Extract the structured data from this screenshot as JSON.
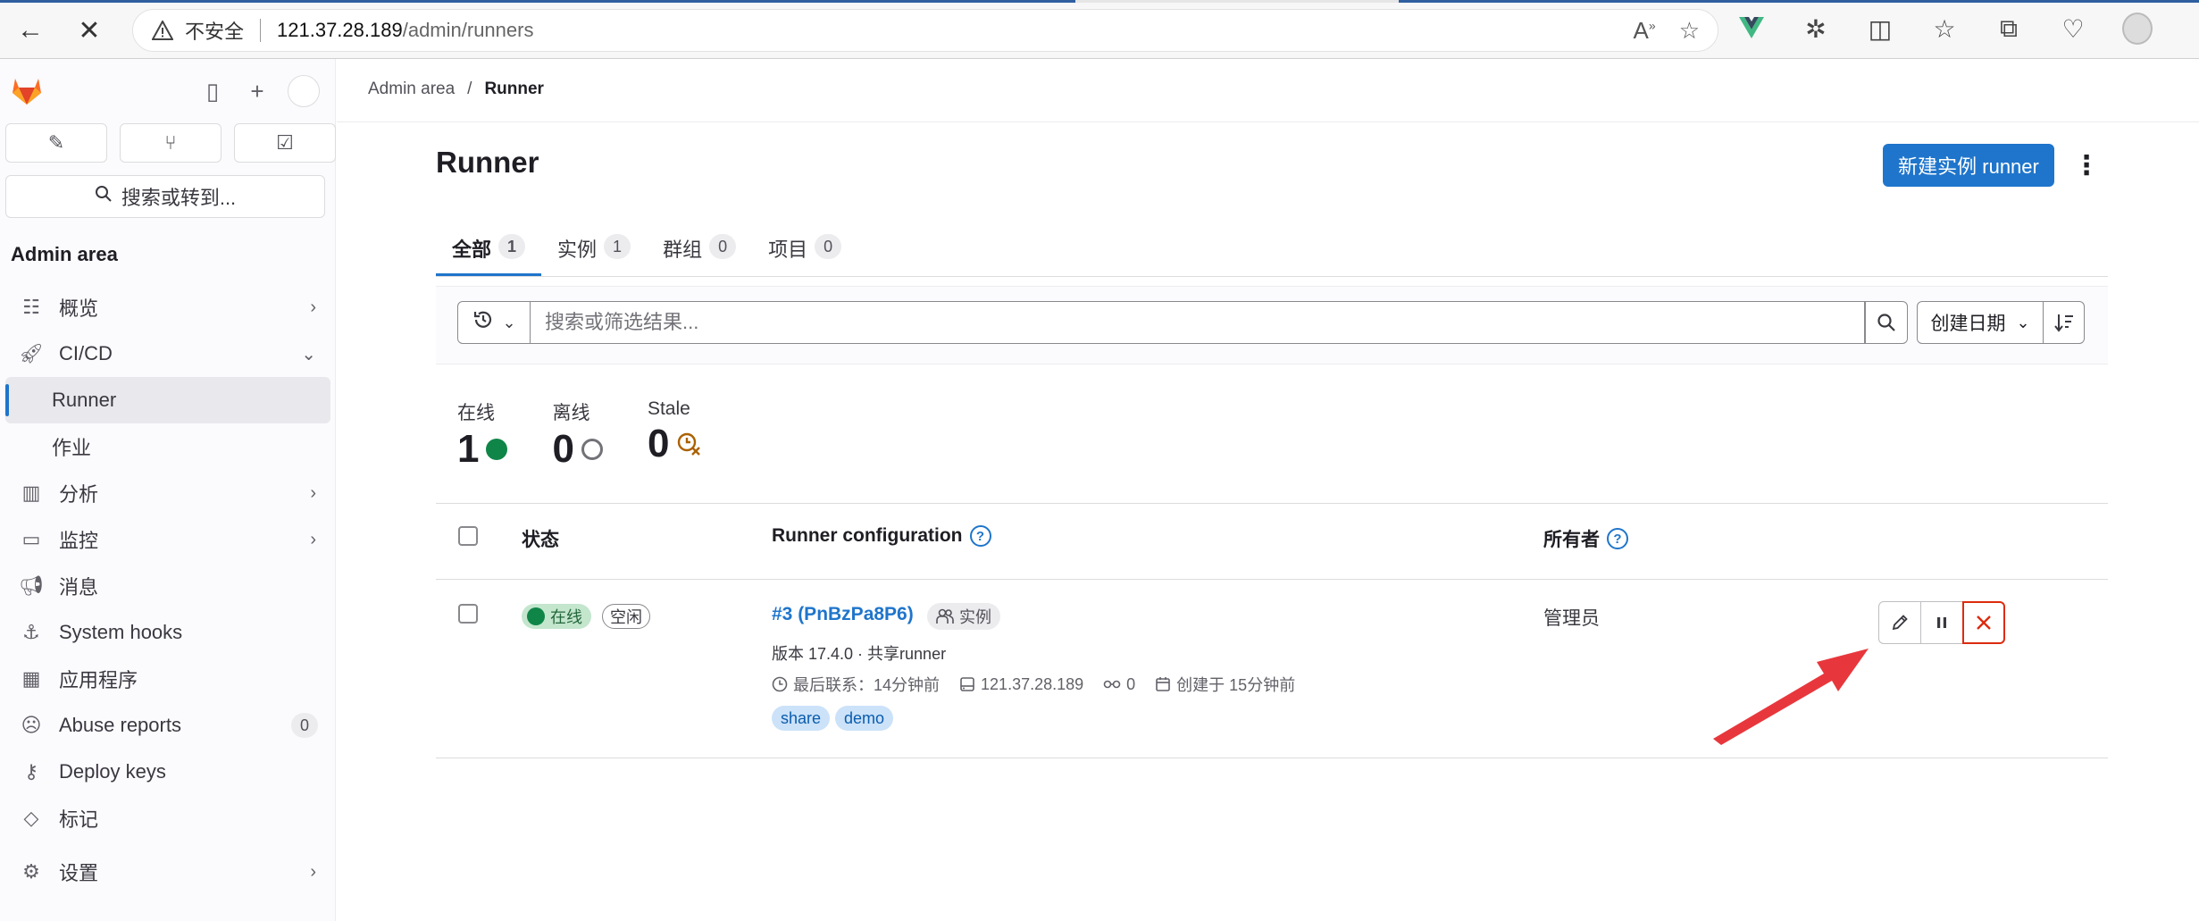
{
  "browser": {
    "insecure_label": "不安全",
    "url_host": "121.37.28.189",
    "url_path": "/admin/runners"
  },
  "sidebar": {
    "search_label": "搜索或转到...",
    "section_title": "Admin area",
    "items": [
      {
        "label": "概览",
        "icon": "overview-icon"
      },
      {
        "label": "CI/CD",
        "icon": "rocket-icon"
      },
      {
        "label": "Runner",
        "icon": ""
      },
      {
        "label": "作业",
        "icon": ""
      },
      {
        "label": "分析",
        "icon": "chart-icon"
      },
      {
        "label": "监控",
        "icon": "monitor-icon"
      },
      {
        "label": "消息",
        "icon": "megaphone-icon"
      },
      {
        "label": "System hooks",
        "icon": "anchor-icon"
      },
      {
        "label": "应用程序",
        "icon": "apps-icon"
      },
      {
        "label": "Abuse reports",
        "icon": "sad-face-icon",
        "count": "0"
      },
      {
        "label": "Deploy keys",
        "icon": "key-icon"
      },
      {
        "label": "标记",
        "icon": "label-icon"
      },
      {
        "label": "设置",
        "icon": "gear-icon"
      }
    ]
  },
  "breadcrumb": {
    "parent": "Admin area",
    "separator": "/",
    "current": "Runner"
  },
  "page": {
    "title": "Runner",
    "new_button": "新建实例 runner"
  },
  "tabs": [
    {
      "label": "全部",
      "count": "1"
    },
    {
      "label": "实例",
      "count": "1"
    },
    {
      "label": "群组",
      "count": "0"
    },
    {
      "label": "项目",
      "count": "0"
    }
  ],
  "filter": {
    "placeholder": "搜索或筛选结果...",
    "sort_label": "创建日期"
  },
  "stats": [
    {
      "label": "在线",
      "value": "1"
    },
    {
      "label": "离线",
      "value": "0"
    },
    {
      "label": "Stale",
      "value": "0"
    }
  ],
  "table": {
    "headers": {
      "status": "状态",
      "config": "Runner configuration",
      "owner": "所有者"
    },
    "rows": [
      {
        "status_online": "在线",
        "status_idle": "空闲",
        "runner_name": "#3 (PnBzPa8P6)",
        "runner_type": "实例",
        "version": "版本 17.4.0 · 共享runner",
        "last_contact": "最后联系：14分钟前",
        "ip": "121.37.28.189",
        "jobs": "0",
        "created": "创建于 15分钟前",
        "tags": [
          "share",
          "demo"
        ],
        "owner": "管理员"
      }
    ]
  },
  "colors": {
    "primary": "#1f75cb",
    "online": "#108548",
    "danger": "#dd2b0e",
    "annotation_arrow": "#e8373c"
  }
}
